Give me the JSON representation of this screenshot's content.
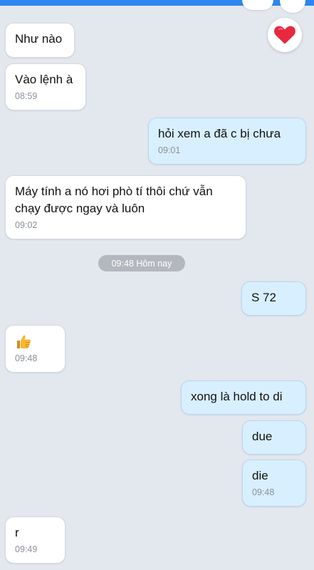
{
  "messages": [
    {
      "id": "m1",
      "side": "in",
      "text": "Như nào",
      "time": ""
    },
    {
      "id": "m2",
      "side": "in",
      "text": "Vào lệnh à",
      "time": "08:59"
    },
    {
      "id": "m3",
      "side": "out",
      "text": "hỏi xem a đã c bị chưa",
      "time": "09:01"
    },
    {
      "id": "m4",
      "side": "in",
      "text_line1": "Máy tính a nó hơi phò tí thôi chứ vẫn",
      "text_line2": "chạy được ngay và luôn",
      "time": "09:02"
    },
    {
      "id": "m5",
      "side": "out",
      "text": "S 72",
      "time": ""
    },
    {
      "id": "m6",
      "side": "in",
      "emoji": "thumbs-up",
      "time": "09:48"
    },
    {
      "id": "m7",
      "side": "out",
      "text": "xong là hold to di",
      "time": ""
    },
    {
      "id": "m8",
      "side": "out",
      "text": "due",
      "time": ""
    },
    {
      "id": "m9",
      "side": "out",
      "text": "die",
      "time": "09:48"
    },
    {
      "id": "m10",
      "side": "in",
      "text": "r",
      "time": "09:49"
    }
  ],
  "date_separator": "09:48 Hôm nay",
  "reaction": {
    "icon": "heart-icon",
    "color": "#e8283d"
  },
  "colors": {
    "background": "#e3e7ee",
    "outgoing": "#d8efff",
    "incoming": "#ffffff",
    "accent": "#2e86f2"
  }
}
